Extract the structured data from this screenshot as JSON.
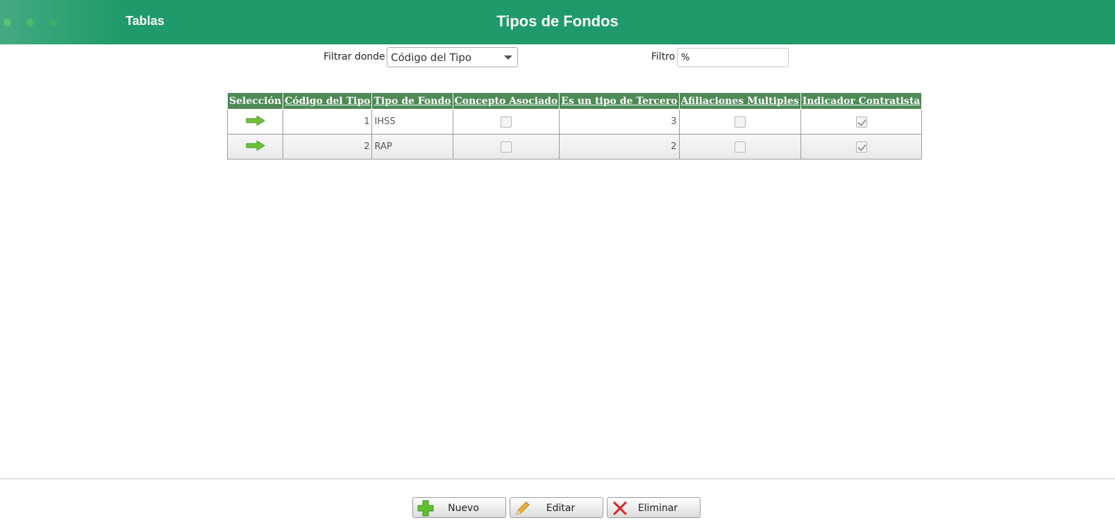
{
  "header": {
    "nav_label": "Tablas",
    "title": "Tipos de Fondos",
    "color": "#1f9a6a"
  },
  "filter": {
    "label": "Filtrar donde",
    "selected": "Código del Tipo",
    "filtro_label": "Filtro",
    "filtro_value": "%"
  },
  "table": {
    "columns": [
      "Selección",
      "Código del Tipo",
      "Tipo de Fondo",
      "Concepto Asociado",
      "Es un tipo de Tercero",
      "Afiliaciones Multiples",
      "Indicador Contratista"
    ],
    "header_color": "#4d8a56",
    "rows": [
      {
        "codigo": "1",
        "tipo": "IHSS",
        "concepto_asociado": false,
        "tercero": "3",
        "afiliaciones": false,
        "contratista": true
      },
      {
        "codigo": "2",
        "tipo": "RAP",
        "concepto_asociado": false,
        "tercero": "2",
        "afiliaciones": false,
        "contratista": true
      }
    ],
    "select_icon": "green-arrow-right-icon"
  },
  "buttons": {
    "nuevo": "Nuevo",
    "editar": "Editar",
    "eliminar": "Eliminar"
  }
}
